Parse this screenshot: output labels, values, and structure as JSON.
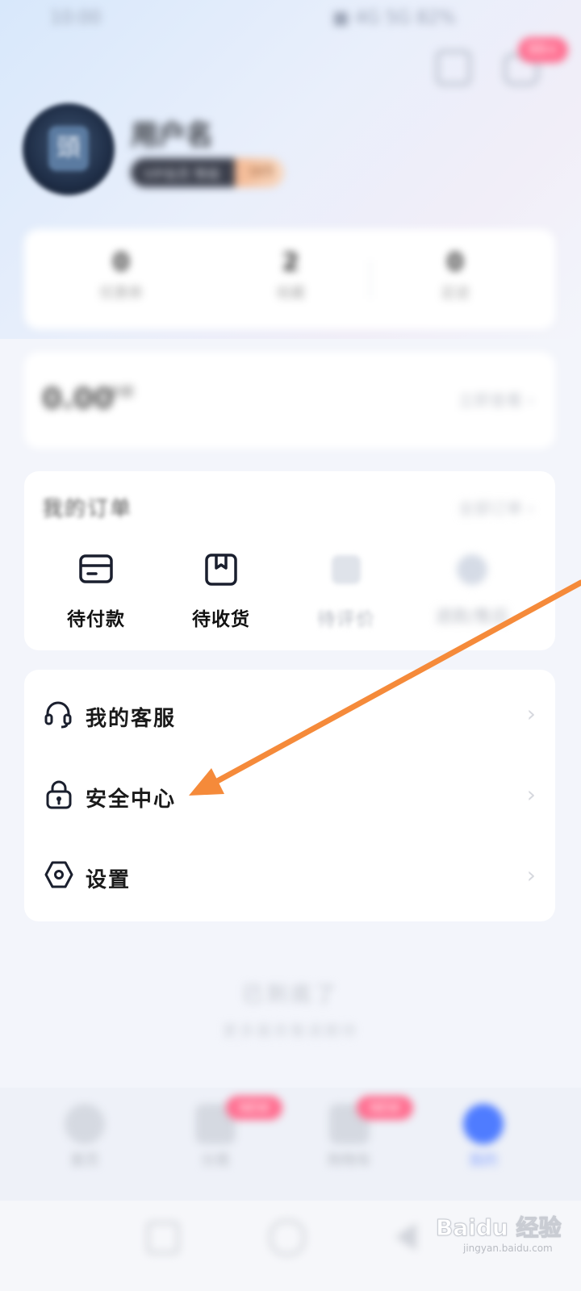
{
  "status_bar": {
    "time": "10:00",
    "indicators": "■ 4G 5G 82%"
  },
  "header": {
    "scan_icon": "scan-icon",
    "message_icon": "message-icon",
    "message_badge": "99+"
  },
  "profile": {
    "avatar_letter": "頭",
    "username": "用户名",
    "member_tag": "VIP会员 等级",
    "member_level": "LV3"
  },
  "stats": [
    {
      "value": "0",
      "label": "优惠券"
    },
    {
      "value": "2",
      "label": "收藏"
    },
    {
      "value": "0",
      "label": "足迹"
    }
  ],
  "wallet": {
    "amount": "0.00",
    "unit": "余额",
    "link": "立即查看 ›"
  },
  "orders": {
    "title": "我的订单",
    "all_link": "全部订单 ›",
    "items": [
      {
        "label": "待付款",
        "icon": "card-icon"
      },
      {
        "label": "待收货",
        "icon": "package-icon"
      },
      {
        "label": "待评价",
        "icon": "review-icon"
      },
      {
        "label": "退款/售后",
        "icon": "refund-icon"
      }
    ]
  },
  "menu": [
    {
      "label": "我的客服",
      "icon": "headset-icon"
    },
    {
      "label": "安全中心",
      "icon": "lock-icon"
    },
    {
      "label": "设置",
      "icon": "settings-icon"
    }
  ],
  "footer": {
    "line1": "已到底了",
    "line2": "更多服务敬请期待"
  },
  "bottom_nav": [
    {
      "label": "首页",
      "icon": "home-icon"
    },
    {
      "label": "分类",
      "icon": "category-icon",
      "badge": "NEW"
    },
    {
      "label": "购物车",
      "icon": "cart-icon",
      "badge": "NEW"
    },
    {
      "label": "我的",
      "icon": "profile-icon"
    }
  ],
  "watermark": "Baidu 经验",
  "watermark_url": "jingyan.baidu.com",
  "colors": {
    "accent": "#4f7cff",
    "arrow": "#f58a3a",
    "badge": "#ff6f91"
  }
}
